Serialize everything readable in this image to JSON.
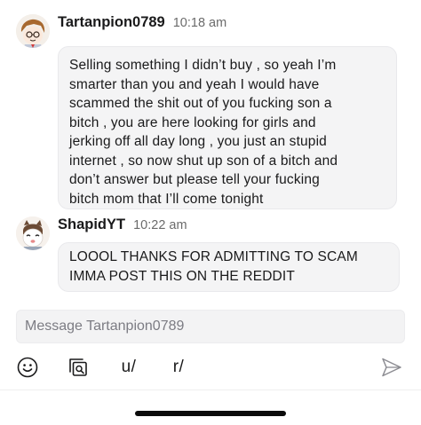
{
  "conversation": {
    "messages": [
      {
        "username": "Tartanpion0789",
        "time": "10:18 am",
        "text": "Selling something I didn’t buy , so yeah I’m\nsmarter than you and yeah I would have\nscammed the shit out of you fucking son a\nbitch , you are here looking for girls and\njerking off all day long , you just an stupid\ninternet , so now shut up son of a bitch and\ndon’t answer but please tell your fucking\nbitch mom that I’ll come tonight"
      },
      {
        "username": "ShapidYT",
        "time": "10:22 am",
        "text": "LOOOL THANKS FOR ADMITTING TO SCAM\nIMMA POST THIS ON THE REDDIT"
      }
    ]
  },
  "composer": {
    "placeholder": "Message Tartanpion0789"
  },
  "toolbar": {
    "user_label": "u/",
    "subreddit_label": "r/",
    "icons": [
      "smiley-icon",
      "gallery-icon",
      "send-icon"
    ]
  },
  "colors": {
    "bubble": "#f4f4f5",
    "composer": "#f3f3f4",
    "timestamp": "#6b6b6b",
    "placeholder": "#7c7c83"
  }
}
